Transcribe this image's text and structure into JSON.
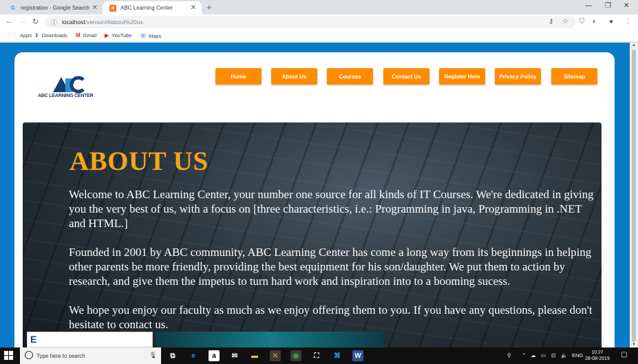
{
  "browser": {
    "tabs": [
      {
        "title": "registration - Google Search",
        "favicon": "google-g-icon"
      },
      {
        "title": "ABC Learning Center",
        "favicon": "xampp-icon"
      }
    ],
    "address": {
      "host": "localhost",
      "path": "/venson/#about%20us"
    },
    "bookmarks": [
      {
        "label": "Apps",
        "icon": "apps-grid-icon"
      },
      {
        "label": "Downloads",
        "icon": "download-icon"
      },
      {
        "label": "Gmail",
        "icon": "gmail-icon"
      },
      {
        "label": "YouTube",
        "icon": "youtube-icon"
      },
      {
        "label": "Maps",
        "icon": "maps-icon"
      }
    ]
  },
  "site": {
    "logo_text": "ABC LEARNING CENTER",
    "nav": [
      {
        "label": "Home"
      },
      {
        "label": "About Us"
      },
      {
        "label": "Courses"
      },
      {
        "label": "Contact Us"
      },
      {
        "label": "Register Here"
      },
      {
        "label": "Privacy Policy"
      },
      {
        "label": "Sitemap"
      }
    ],
    "accent": "#ff8c00",
    "heading_color": "#f4a51c",
    "about": {
      "heading": "ABOUT US",
      "p1": "Welcome to ABC Learning Center, your number one source for all kinds of IT Courses. We're dedicated in giving you the very best of us, with a focus on [three characteristics, i.e.: Programming in java, Programming in .NET and HTML.]",
      "p2": "Founded in 2001 by ABC community, ABC Learning Center has come a long way from its beginnings in helping other parents be more friendly, providing the best equipment for his son/daughter. We put them to action by research, and give them the impetus to turn hard work and inspiration into to a booming sucess.",
      "p3": "We hope you enjoy our faculty as much as we enjoy offering them to you. If you have any questions, please don't hesitate to contact us."
    }
  },
  "taskbar": {
    "search_placeholder": "Type here to search",
    "lang": "ENG",
    "time": "10:27",
    "date": "28-08-2019"
  }
}
